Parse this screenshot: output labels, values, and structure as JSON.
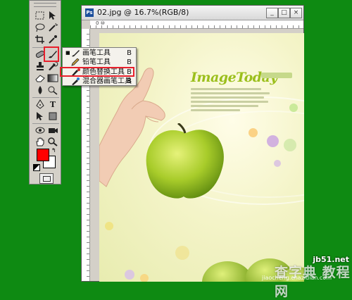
{
  "window": {
    "title": "02.jpg @ 16.7%(RGB/8)",
    "app_logo": "Ps",
    "btn_min": "_",
    "btn_max": "□",
    "btn_close": "×"
  },
  "ruler": {
    "top_labels": "0  ⑩"
  },
  "toolbox": {
    "selected_tool": "brush-tool",
    "foreground_color": "#ff0000",
    "background_color": "#ffffff"
  },
  "flyout": {
    "items": [
      {
        "label": "画笔工具",
        "shortcut": "B",
        "active": true,
        "icon": "brush-icon"
      },
      {
        "label": "铅笔工具",
        "shortcut": "B",
        "active": false,
        "icon": "pencil-icon"
      },
      {
        "label": "颜色替换工具",
        "shortcut": "B",
        "active": false,
        "icon": "color-replace-icon"
      },
      {
        "label": "混合器画笔工具",
        "shortcut": "B",
        "active": false,
        "icon": "mixer-brush-icon"
      }
    ]
  },
  "artwork": {
    "brand": "ImageToday",
    "accent": "#9bbf1c"
  },
  "watermark": {
    "site": "jb51.net",
    "text": "查字典 教程网",
    "url": "jiaocheng.chazidian.com"
  }
}
